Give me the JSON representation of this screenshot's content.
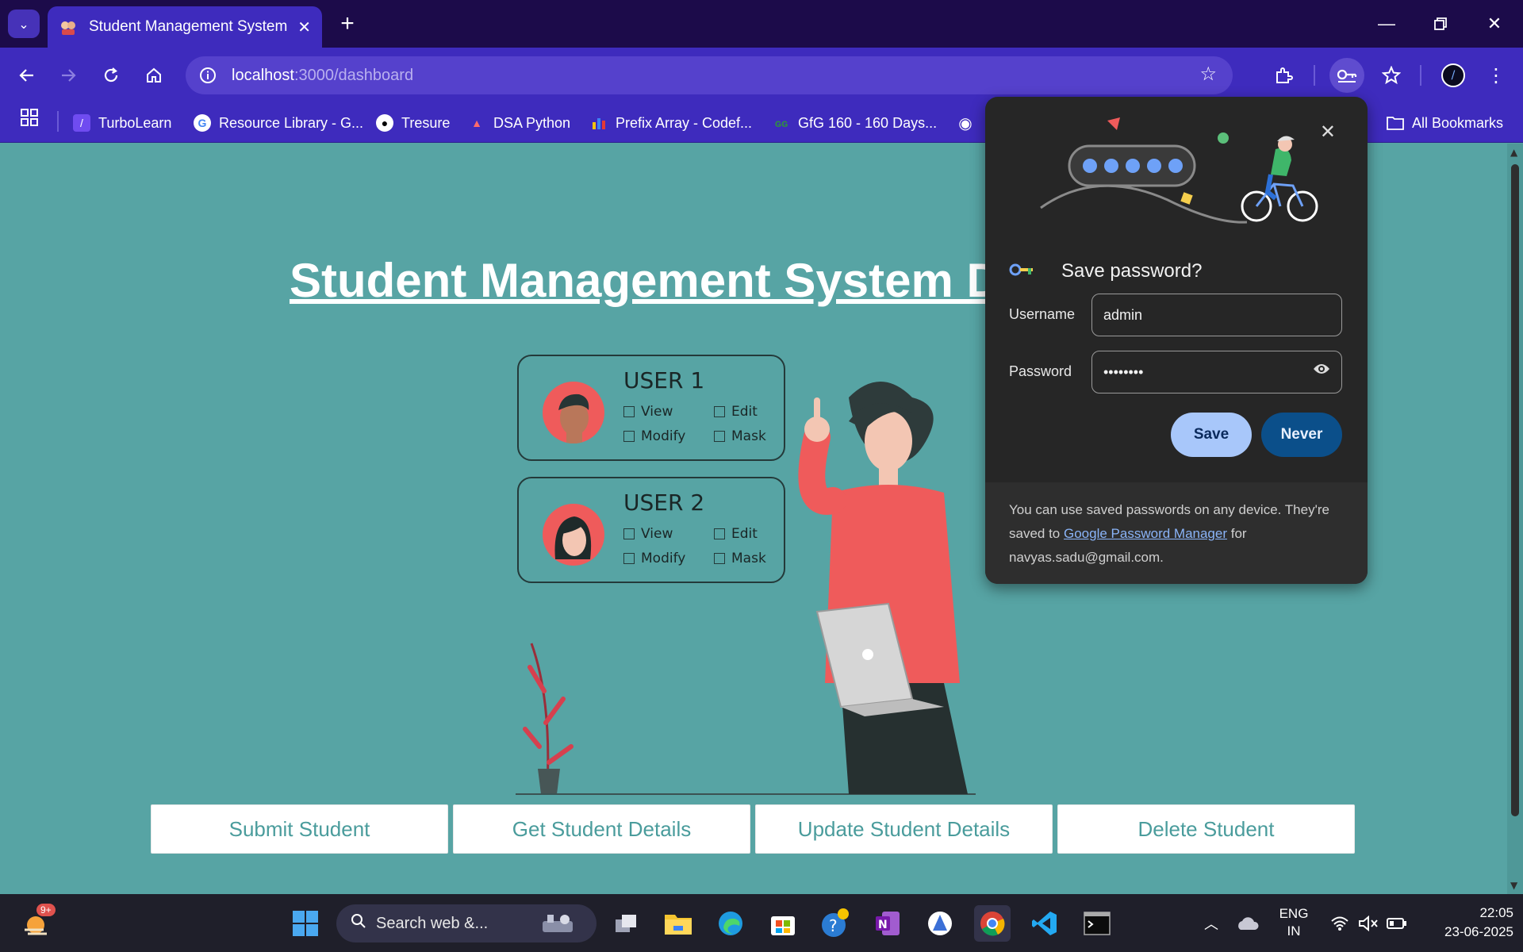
{
  "browser": {
    "tab_title": "Student Management System",
    "tab_close": "✕",
    "new_tab": "+",
    "url_host": "localhost",
    "url_path": ":3000/dashboard"
  },
  "bookmarks": [
    {
      "label": "TurboLearn",
      "icon": "turbolearn-icon"
    },
    {
      "label": "Resource Library - G...",
      "icon": "google-icon"
    },
    {
      "label": "Tresure",
      "icon": "github-icon"
    },
    {
      "label": "DSA Python",
      "icon": "dsa-icon"
    },
    {
      "label": "Prefix Array - Codef...",
      "icon": "chart-icon"
    },
    {
      "label": "GfG 160 - 160 Days...",
      "icon": "gfg-icon"
    },
    {
      "label": "All Bookmarks",
      "icon": "folder-icon"
    }
  ],
  "page": {
    "title": "Student Management System Dashboard",
    "actions": [
      "Submit Student",
      "Get Student Details",
      "Update Student Details",
      "Delete Student"
    ],
    "illustration": {
      "users": [
        {
          "name": "USER 1",
          "perms": [
            "View",
            "Edit",
            "Modify",
            "Mask"
          ]
        },
        {
          "name": "USER 2",
          "perms": [
            "View",
            "Edit",
            "Modify",
            "Mask"
          ]
        }
      ]
    }
  },
  "password_bubble": {
    "heading": "Save password?",
    "username_label": "Username",
    "username_value": "admin",
    "password_label": "Password",
    "password_value": "••••••••",
    "save_label": "Save",
    "never_label": "Never",
    "footer_before": "You can use saved passwords on any device. They're saved to",
    "footer_link": "Google Password Manager",
    "footer_after": "for navyas.sadu@gmail.com."
  },
  "taskbar": {
    "notification_badge": "9+",
    "search_placeholder": "Search web &...",
    "lang_line1": "ENG",
    "lang_line2": "IN",
    "time": "22:05",
    "date": "23-06-2025"
  },
  "colors": {
    "chrome_frame": "#1c0b4a",
    "chrome_toolbar": "#3e2bbd",
    "page_bg": "#57a4a4",
    "button_text": "#4a9c9c",
    "bubble_bg": "#262626",
    "save_btn": "#a8c7fa",
    "never_btn": "#0b4f8a"
  }
}
